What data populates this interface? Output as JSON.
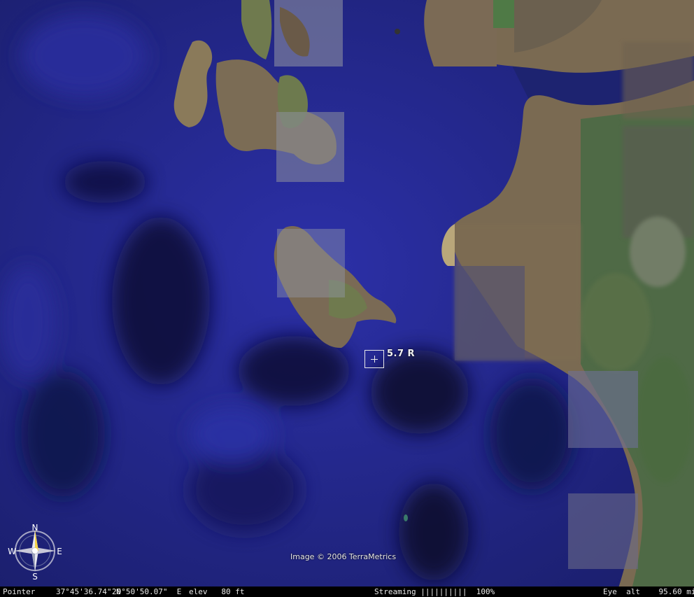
{
  "map": {
    "marker_label": "5.7 R",
    "credit": "Image © 2006 TerraMetrics"
  },
  "compass": {
    "north": "N",
    "south": "S",
    "east": "E",
    "west": "W"
  },
  "status_bar": {
    "pointer_label": "Pointer",
    "latitude": "37°45'36.74\" N",
    "longitude": "20°50'50.07\"  E",
    "elevation": "elev   80 ft",
    "streaming": "Streaming ||||||||||  100%",
    "eye_altitude": "Eye  alt    95.60 mi"
  }
}
